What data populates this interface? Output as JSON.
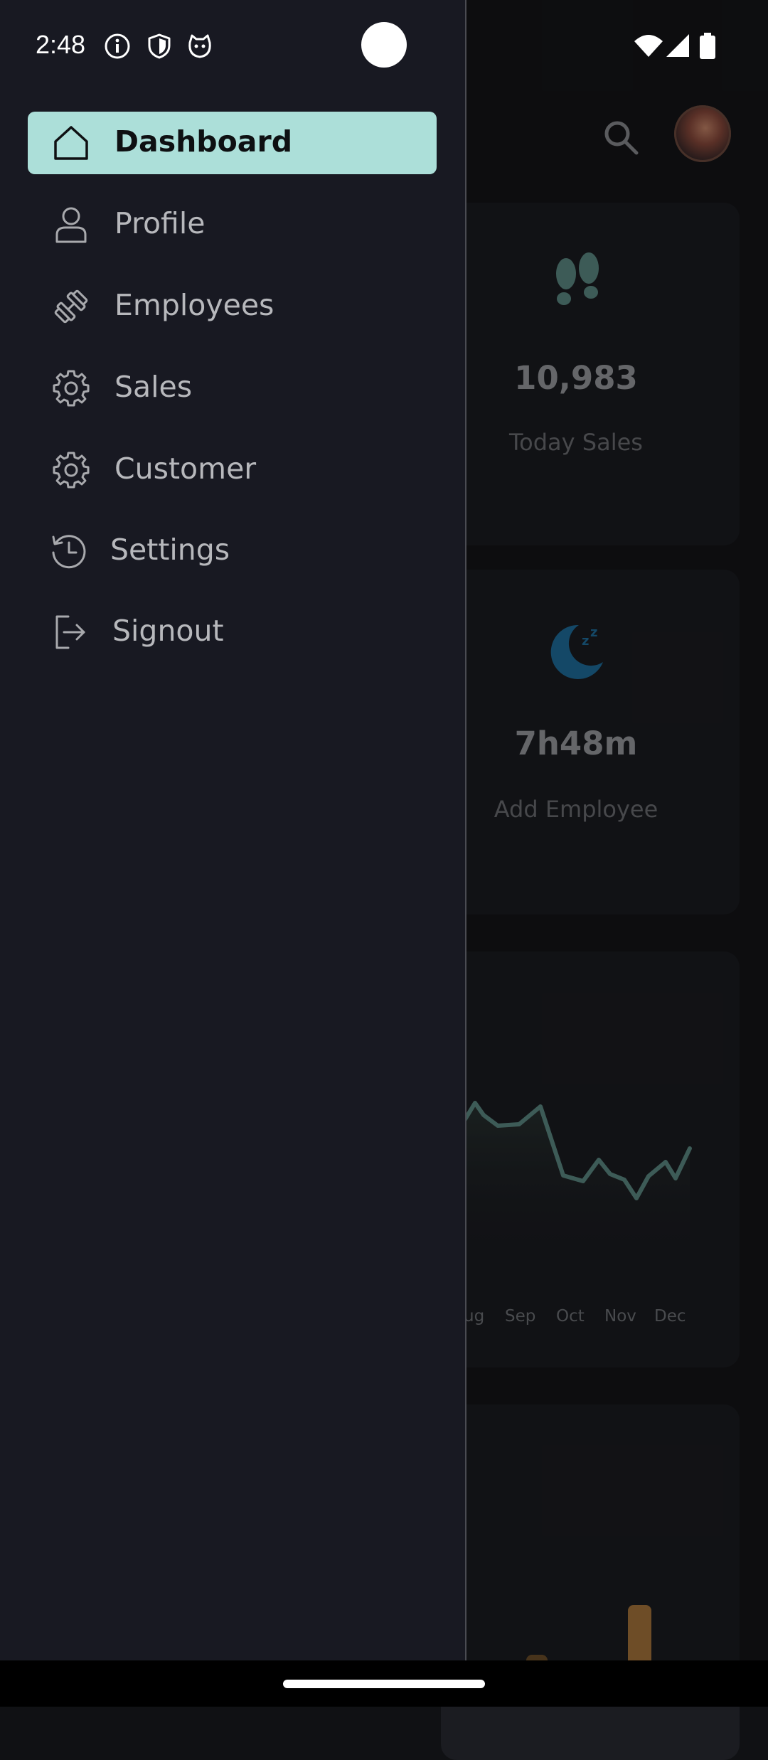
{
  "status_bar": {
    "time": "2:48",
    "left_icons": [
      "info-icon",
      "shield-icon",
      "cat-icon"
    ],
    "right_icons": [
      "wifi-icon",
      "signal-icon",
      "battery-icon"
    ]
  },
  "drawer": {
    "items": [
      {
        "label": "Dashboard",
        "icon": "home-icon",
        "active": true
      },
      {
        "label": "Profile",
        "icon": "person-icon",
        "active": false
      },
      {
        "label": "Employees",
        "icon": "dumbbell-icon",
        "active": false
      },
      {
        "label": "Sales",
        "icon": "gear-icon",
        "active": false
      },
      {
        "label": "Customer",
        "icon": "gear-icon",
        "active": false
      },
      {
        "label": "Settings",
        "icon": "history-icon",
        "active": false
      },
      {
        "label": "Signout",
        "icon": "logout-icon",
        "active": false
      }
    ]
  },
  "dashboard": {
    "header_icons": [
      "search-icon",
      "avatar"
    ],
    "cards": [
      {
        "value": "10,983",
        "label": "Today Sales",
        "icon": "footprints-icon",
        "icon_color": "#5e8d86"
      },
      {
        "value": "7h48m",
        "label": "Add Employee",
        "icon": "sleep-moon-icon",
        "icon_color": "#1f6f9e"
      }
    ],
    "chart": {
      "months": [
        "ug",
        "Sep",
        "Oct",
        "Nov",
        "Dec"
      ],
      "line_color": "#5e8d86"
    },
    "bars_color": "#a9773c"
  },
  "colors": {
    "drawer_bg": "#181922",
    "active_item_bg": "#acdfd9",
    "app_bg": "#141518"
  }
}
